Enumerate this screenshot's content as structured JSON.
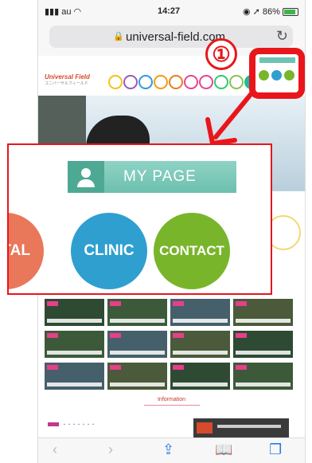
{
  "status_bar": {
    "carrier": "au",
    "time": "14:27",
    "battery": "86%",
    "battery_level": 0.86
  },
  "browser": {
    "url": "universal-field.com"
  },
  "site": {
    "logo": "Universal Field",
    "nav_colors": [
      "#f2c318",
      "#9b59b6",
      "#3498db",
      "#f39c12",
      "#e67e22",
      "#e84393",
      "#e84393",
      "#2ecc71",
      "#8bc34a",
      "#1abc9c",
      "#27ae60",
      "#16a085"
    ],
    "info_heading": "Information"
  },
  "callout": {
    "number": "①"
  },
  "zoomed": {
    "mypage_label": "MY PAGE",
    "buttons": [
      {
        "label": "ENTAL",
        "color": "#e9775a"
      },
      {
        "label": "CLINIC",
        "color": "#2f9fd0"
      },
      {
        "label": "CONTACT",
        "color": "#79b52b"
      }
    ]
  },
  "colors": {
    "highlight": "#e8161b",
    "mypage": "#6fc3b4"
  }
}
